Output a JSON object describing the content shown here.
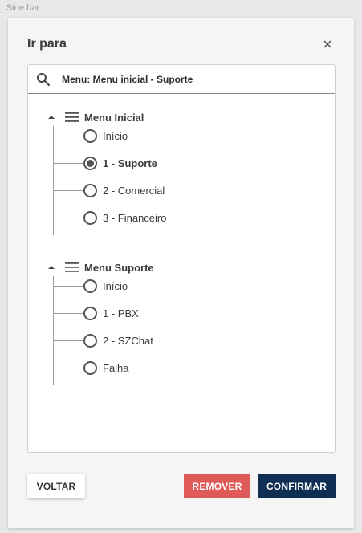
{
  "frame_label": "Side bar",
  "dialog": {
    "title": "Ir para",
    "close_label": "×"
  },
  "search": {
    "value": "Menu: Menu inicial - Suporte",
    "placeholder": ""
  },
  "groups": [
    {
      "title": "Menu Inicial",
      "items": [
        {
          "label": "Início",
          "selected": false
        },
        {
          "label": "1 - Suporte",
          "selected": true
        },
        {
          "label": "2 - Comercial",
          "selected": false
        },
        {
          "label": "3 - Financeiro",
          "selected": false
        }
      ]
    },
    {
      "title": "Menu Suporte",
      "items": [
        {
          "label": "Início",
          "selected": false
        },
        {
          "label": "1 - PBX",
          "selected": false
        },
        {
          "label": "2 - SZChat",
          "selected": false
        },
        {
          "label": "Falha",
          "selected": false
        }
      ]
    }
  ],
  "buttons": {
    "back": "VOLTAR",
    "remove": "REMOVER",
    "confirm": "CONFIRMAR"
  },
  "colors": {
    "remove": "#e05a5a",
    "confirm": "#0e2f52"
  }
}
